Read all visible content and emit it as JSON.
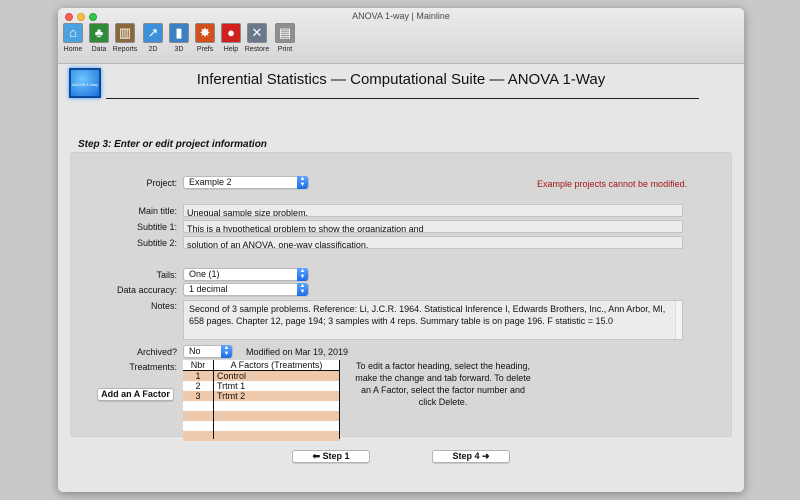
{
  "window": {
    "title": "ANOVA 1-way | Mainline"
  },
  "toolbar": [
    {
      "label": "Home",
      "icon": "home-icon",
      "glyph": "⌂",
      "color": "#4aa3e0"
    },
    {
      "label": "Data",
      "icon": "tree-icon",
      "glyph": "♣",
      "color": "#2f8a3a"
    },
    {
      "label": "Reports",
      "icon": "building-icon",
      "glyph": "▥",
      "color": "#8a6a3a"
    },
    {
      "label": "2D",
      "icon": "line-chart-icon",
      "glyph": "↗",
      "color": "#3c8fd8"
    },
    {
      "label": "3D",
      "icon": "bar-chart-icon",
      "glyph": "▮",
      "color": "#3b7fc4"
    },
    {
      "label": "Prefs",
      "icon": "leaf-icon",
      "glyph": "✸",
      "color": "#d3501c"
    },
    {
      "label": "Help",
      "icon": "lifebuoy-icon",
      "glyph": "●",
      "color": "#d1211f"
    },
    {
      "label": "Restore",
      "icon": "tools-icon",
      "glyph": "✕",
      "color": "#6a7a8a"
    },
    {
      "label": "Print",
      "icon": "printer-icon",
      "glyph": "▤",
      "color": "#8f8f8f"
    }
  ],
  "header": {
    "logo_text": "ANOVA 1-Way",
    "title": "Inferential Statistics — Computational Suite — ANOVA 1-Way"
  },
  "step": {
    "heading": "Step 3: Enter or edit project information"
  },
  "form": {
    "project_label": "Project:",
    "project_value": "Example 2",
    "warning": "Example projects cannot be modified.",
    "main_title_label": "Main title:",
    "main_title_value": "Unequal sample size problem.",
    "subtitle1_label": "Subtitle 1:",
    "subtitle1_value": "This is a hypothetical problem to show the organization and",
    "subtitle2_label": "Subtitle 2:",
    "subtitle2_value": "solution of an ANOVA, one-way classification.",
    "tails_label": "Tails:",
    "tails_value": "One (1)",
    "accuracy_label": "Data accuracy:",
    "accuracy_value": "1 decimal",
    "notes_label": "Notes:",
    "notes_value": "Second of 3 sample problems. Reference:  Li, J.C.R. 1964. Statistical Inference I, Edwards Brothers, Inc., Ann Arbor, MI, 658 pages. Chapter 12, page 194; 3 samples with 4 reps. Summary table is on page 196. F statistic = 15.0",
    "archived_label": "Archived?",
    "archived_value": "No",
    "modified": "Modified on Mar 19, 2019",
    "treatments_label": "Treatments:",
    "add_factor_button": "Add an A Factor"
  },
  "treatments": {
    "col_nbr": "Nbr",
    "col_factor": "A Factors (Treatments)",
    "rows": [
      {
        "nbr": "1",
        "name": "Control"
      },
      {
        "nbr": "2",
        "name": "Trtmt 1"
      },
      {
        "nbr": "3",
        "name": "Trtmt 2"
      },
      {
        "nbr": "",
        "name": ""
      },
      {
        "nbr": "",
        "name": ""
      },
      {
        "nbr": "",
        "name": ""
      },
      {
        "nbr": "",
        "name": ""
      }
    ],
    "stripe_color": "#efc9ab"
  },
  "help_text": "To edit a factor heading, select the heading, make the change and tab forward. To delete an A Factor, select the factor number and click Delete.",
  "nav": {
    "prev": "⬅ Step 1",
    "next": "Step 4 ➜"
  }
}
